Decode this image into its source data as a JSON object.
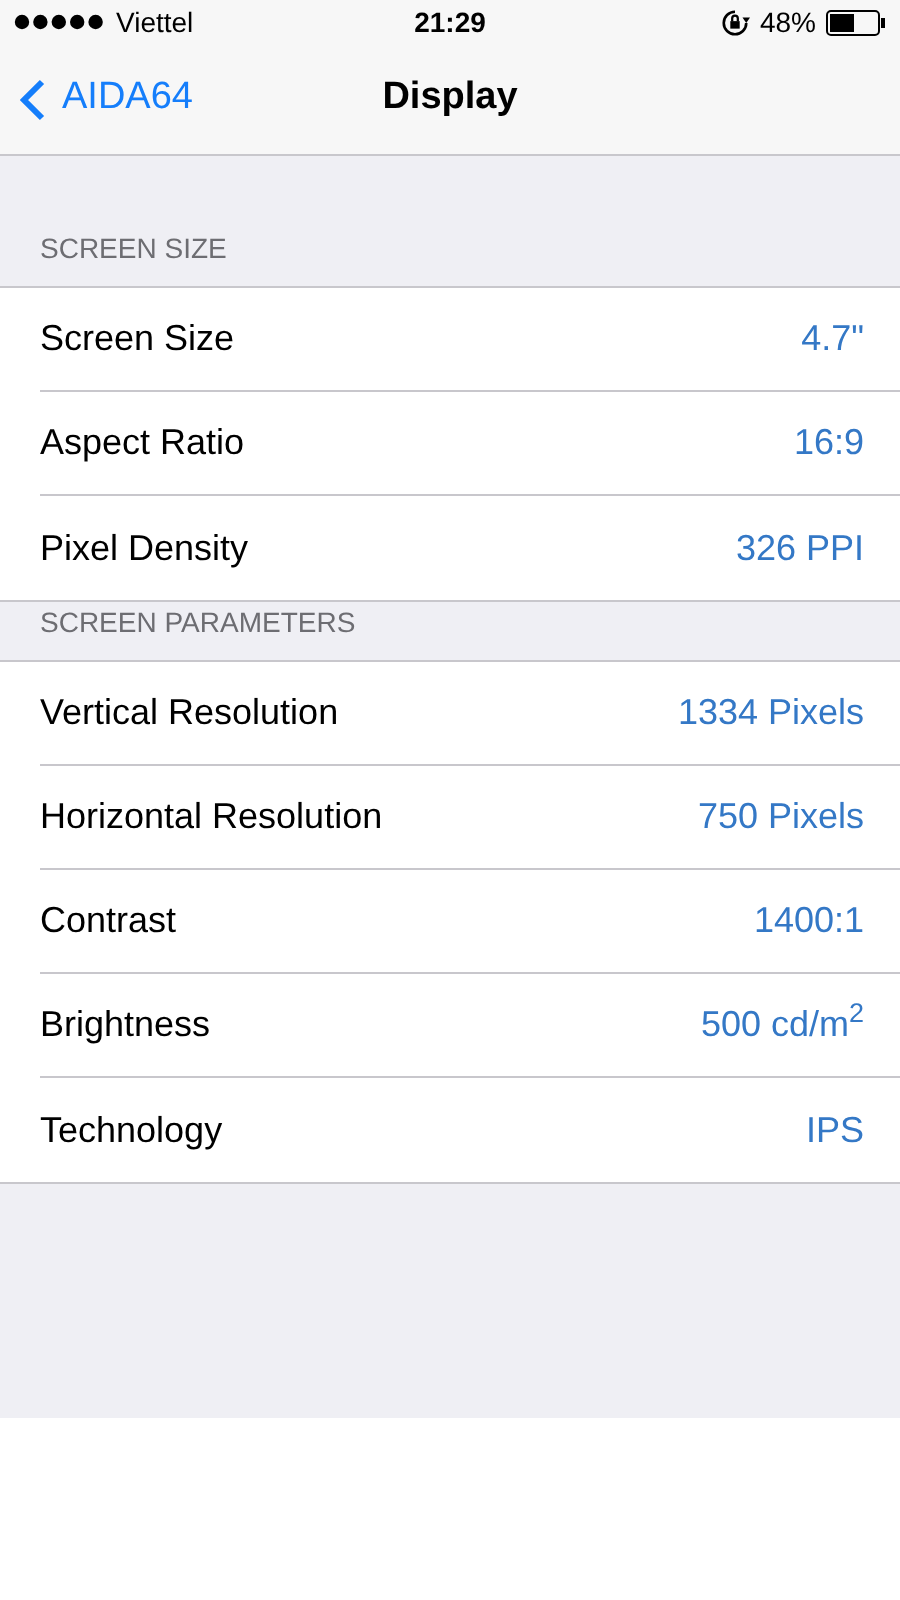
{
  "status_bar": {
    "carrier": "Viettel",
    "time": "21:29",
    "battery": "48%"
  },
  "nav": {
    "back": "AIDA64",
    "title": "Display"
  },
  "sections": [
    {
      "header": "SCREEN SIZE",
      "rows": [
        {
          "label": "Screen Size",
          "value": "4.7\""
        },
        {
          "label": "Aspect Ratio",
          "value": "16:9"
        },
        {
          "label": "Pixel Density",
          "value": "326 PPI"
        }
      ]
    },
    {
      "header": "SCREEN PARAMETERS",
      "rows": [
        {
          "label": "Vertical Resolution",
          "value": "1334 Pixels"
        },
        {
          "label": "Horizontal Resolution",
          "value": "750 Pixels"
        },
        {
          "label": "Contrast",
          "value": "1400:1"
        },
        {
          "label": "Brightness",
          "value": "500 cd/m$^{2}$"
        },
        {
          "label": "Technology",
          "value": "IPS"
        }
      ]
    }
  ]
}
